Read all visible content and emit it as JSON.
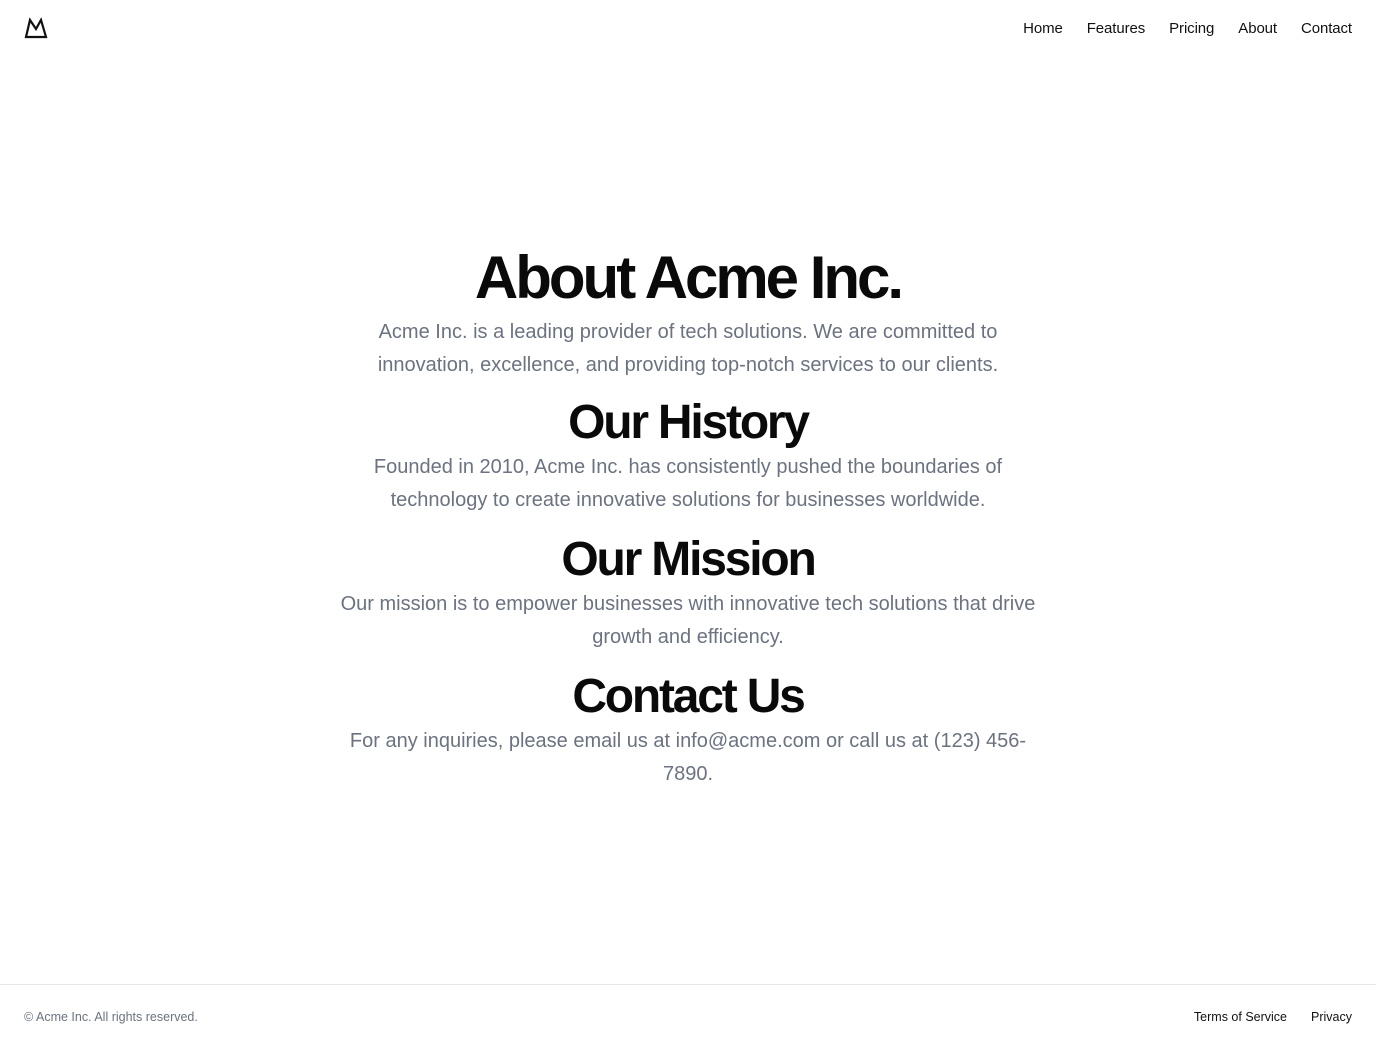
{
  "header": {
    "logo_icon": "mountain-icon",
    "nav": [
      {
        "label": "Home"
      },
      {
        "label": "Features"
      },
      {
        "label": "Pricing"
      },
      {
        "label": "About"
      },
      {
        "label": "Contact"
      }
    ]
  },
  "main": {
    "title": "About Acme Inc.",
    "intro": "Acme Inc. is a leading provider of tech solutions. We are committed to innovation, excellence, and providing top-notch services to our clients.",
    "sections": [
      {
        "heading": "Our History",
        "body": "Founded in 2010, Acme Inc. has consistently pushed the boundaries of technology to create innovative solutions for businesses worldwide."
      },
      {
        "heading": "Our Mission",
        "body": "Our mission is to empower businesses with innovative tech solutions that drive growth and efficiency."
      },
      {
        "heading": "Contact Us",
        "body": "For any inquiries, please email us at info@acme.com or call us at (123) 456-7890."
      }
    ]
  },
  "footer": {
    "copyright": "© Acme Inc. All rights reserved.",
    "links": [
      {
        "label": "Terms of Service"
      },
      {
        "label": "Privacy"
      }
    ]
  },
  "colors": {
    "text_primary": "#0a0a0a",
    "text_muted": "#6b7280",
    "border": "#e5e7eb",
    "background": "#ffffff"
  }
}
